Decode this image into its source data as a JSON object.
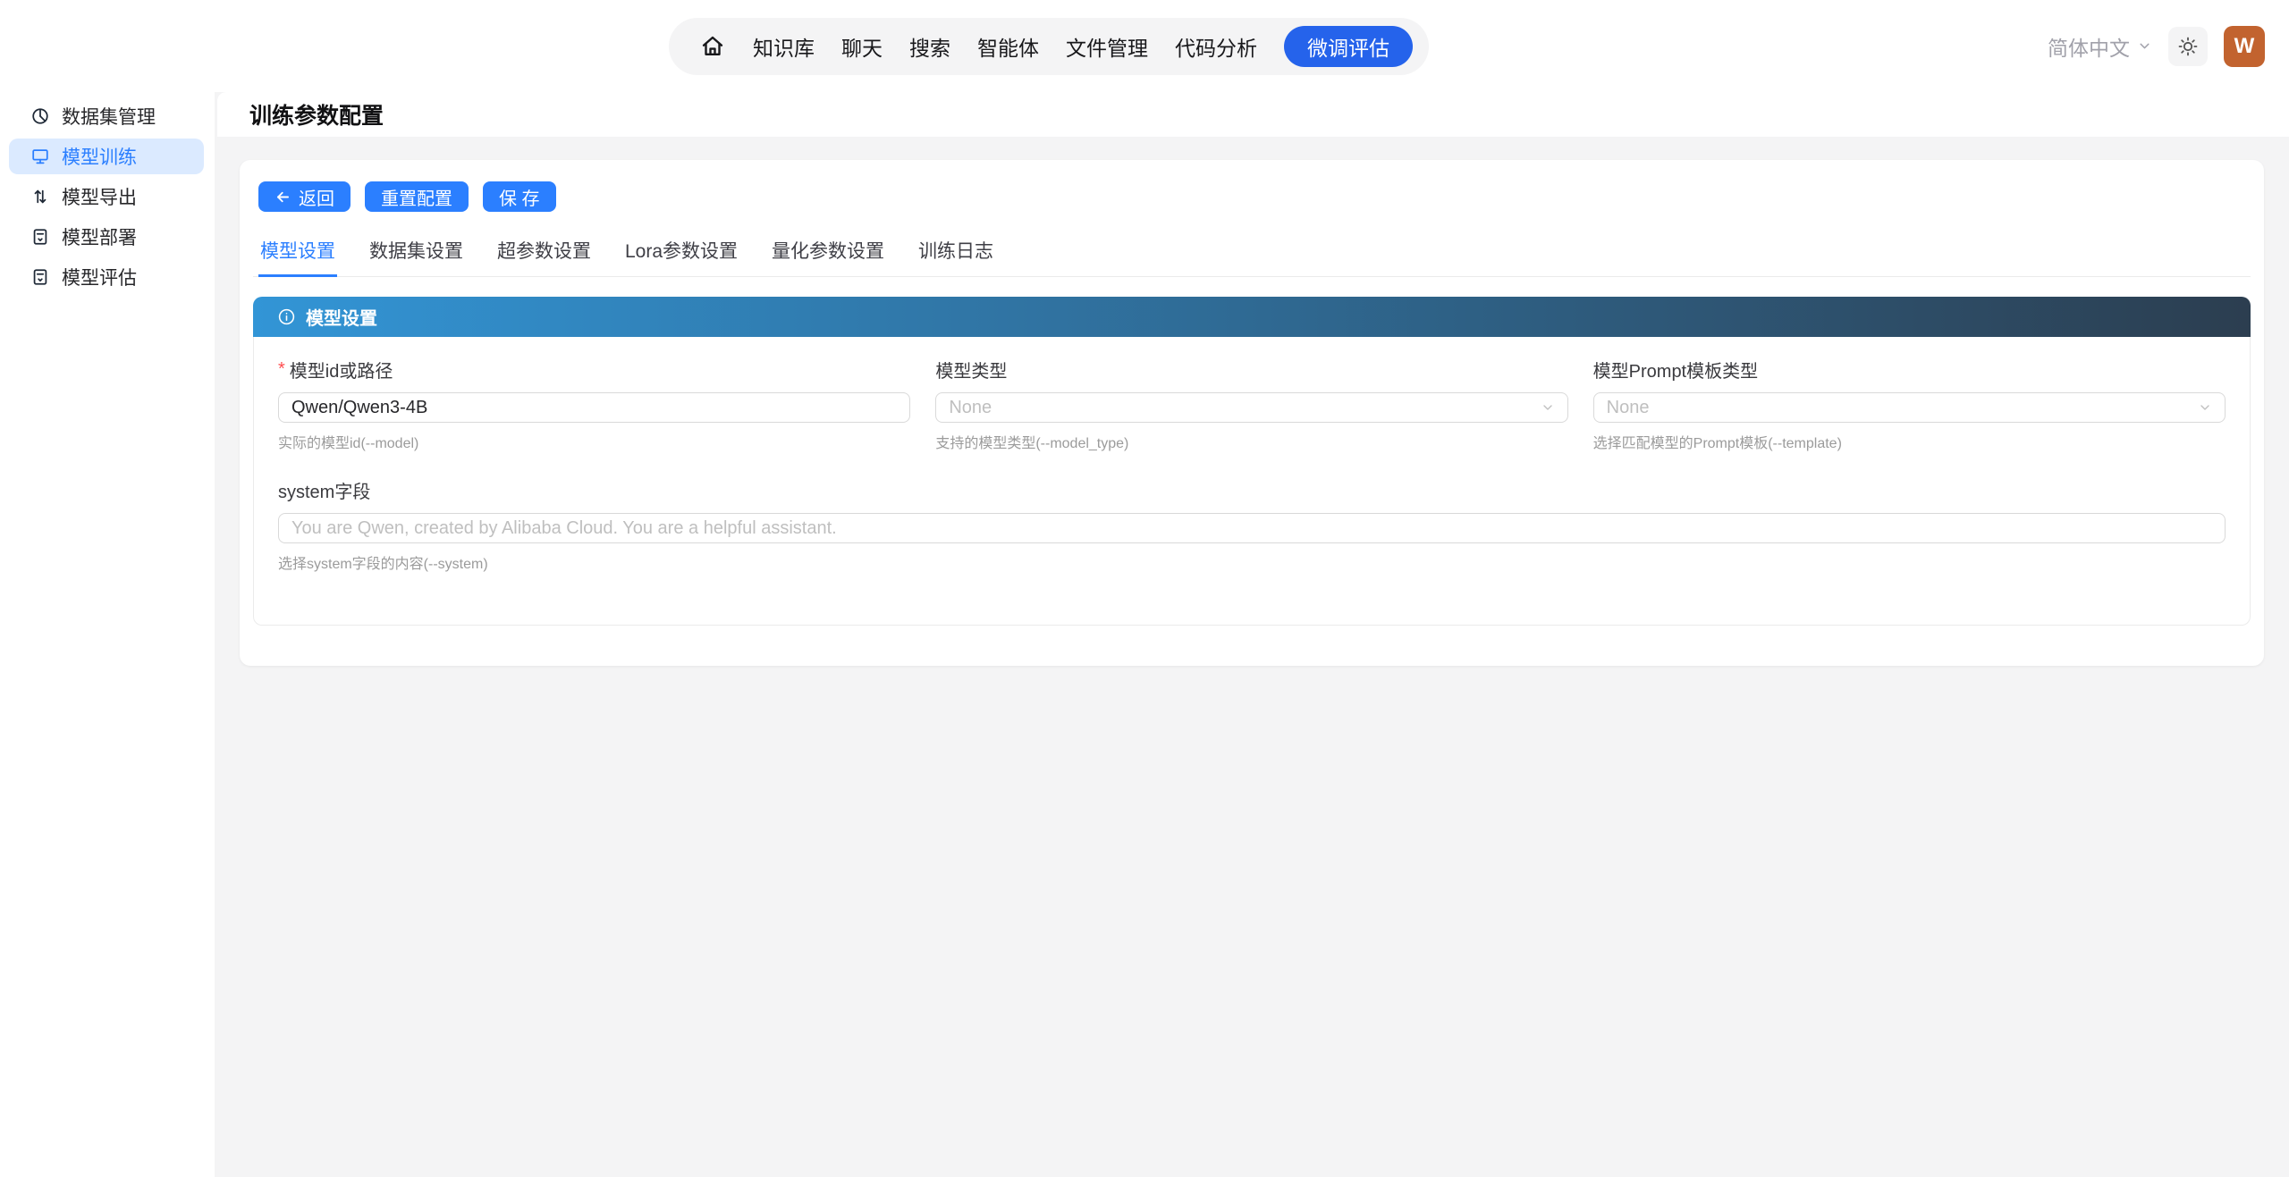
{
  "nav": {
    "items": [
      "知识库",
      "聊天",
      "搜索",
      "智能体",
      "文件管理",
      "代码分析"
    ],
    "active_pill": "微调评估",
    "language": "简体中文",
    "avatar_initial": "W"
  },
  "sidebar": {
    "items": [
      {
        "label": "数据集管理",
        "icon": "pie-chart-icon"
      },
      {
        "label": "模型训练",
        "icon": "monitor-icon"
      },
      {
        "label": "模型导出",
        "icon": "export-arrows-icon"
      },
      {
        "label": "模型部署",
        "icon": "document-icon"
      },
      {
        "label": "模型评估",
        "icon": "document-icon"
      }
    ]
  },
  "page": {
    "title": "训练参数配置"
  },
  "toolbar": {
    "back_label": "返回",
    "reset_label": "重置配置",
    "save_label": "保 存"
  },
  "tabs": [
    "模型设置",
    "数据集设置",
    "超参数设置",
    "Lora参数设置",
    "量化参数设置",
    "训练日志"
  ],
  "panel": {
    "header": "模型设置"
  },
  "form": {
    "fields": [
      {
        "label": "模型id或路径",
        "required": "*",
        "value": "Qwen/Qwen3-4B",
        "helper": "实际的模型id(--model)"
      },
      {
        "label": "模型类型",
        "placeholder": "None",
        "helper": "支持的模型类型(--model_type)"
      },
      {
        "label": "模型Prompt模板类型",
        "placeholder": "None",
        "helper": "选择匹配模型的Prompt模板(--template)"
      },
      {
        "label": "system字段",
        "placeholder": "You are Qwen, created by Alibaba Cloud. You are a helpful assistant.",
        "helper": "选择system字段的内容(--system)"
      }
    ]
  },
  "colors": {
    "primary_blue": "#2b7fff",
    "nav_pill_blue": "#2563eb",
    "sidebar_active_bg": "#dbeaff",
    "header_gradient_start": "#3295d6",
    "header_gradient_end": "#2c3e50",
    "avatar_bg": "#c2632f",
    "page_bg": "#f4f4f5",
    "required_red": "#ff4d4f"
  }
}
